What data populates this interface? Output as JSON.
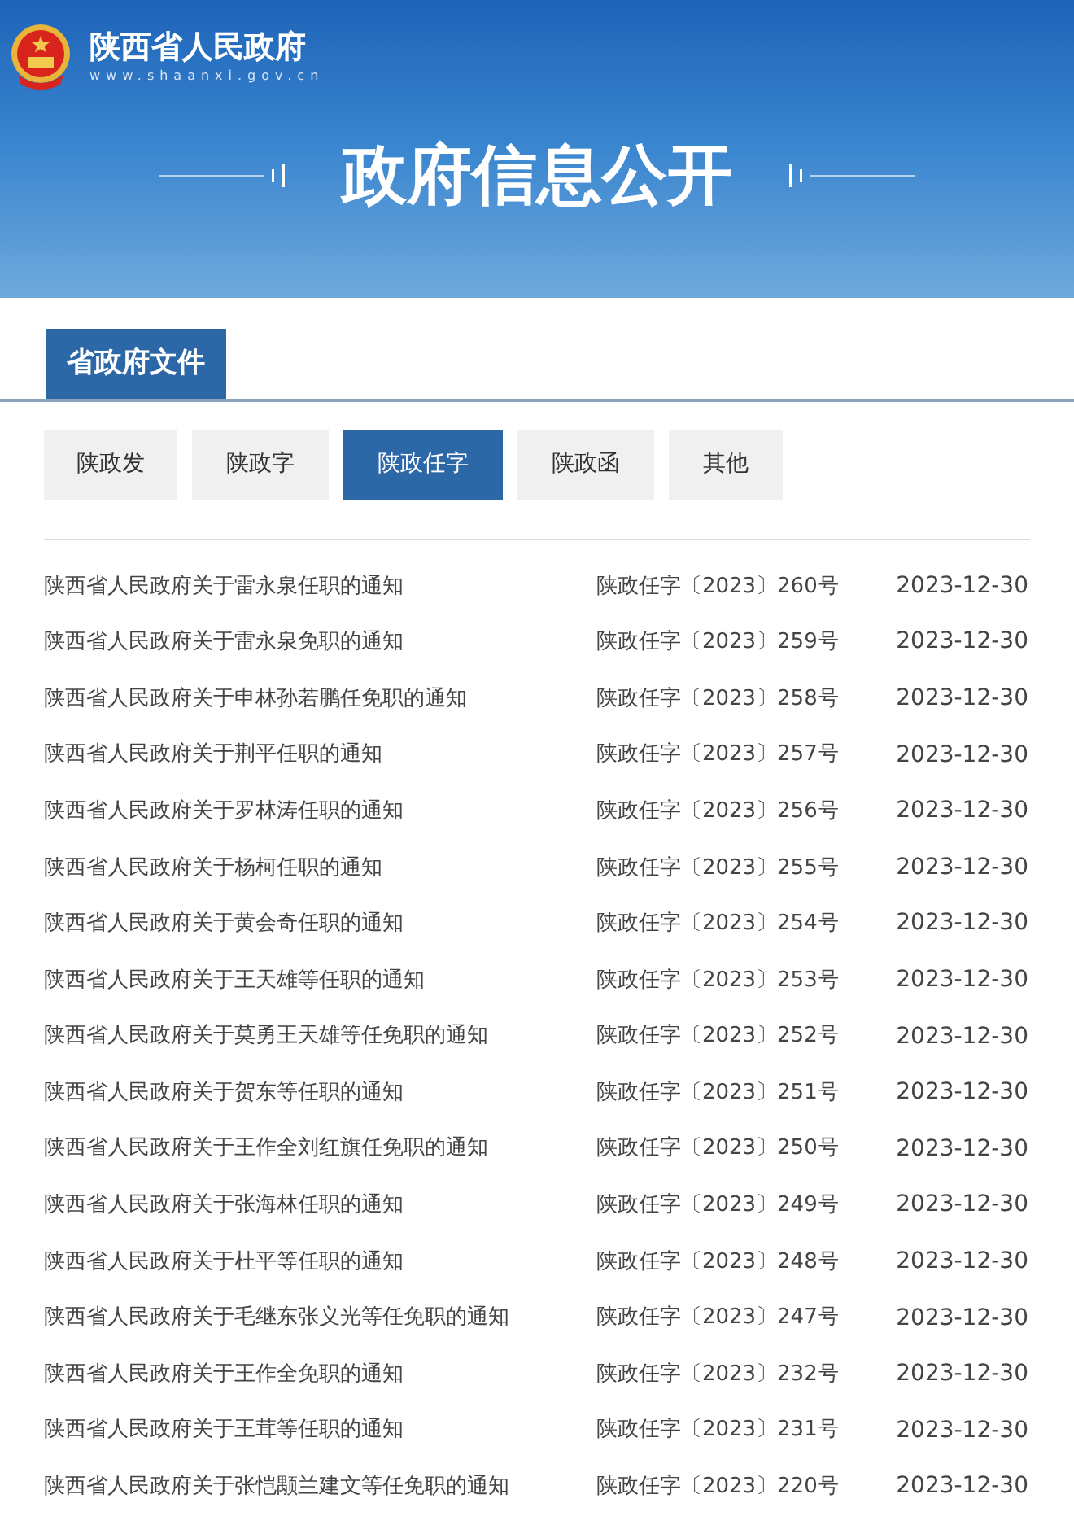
{
  "header": {
    "site_name": "陕西省人民政府",
    "site_url": "www.shaanxi.gov.cn",
    "banner_title": "政府信息公开"
  },
  "section": {
    "title": "省政府文件"
  },
  "tabs": [
    {
      "label": "陕政发",
      "selected": false
    },
    {
      "label": "陕政字",
      "selected": false
    },
    {
      "label": "陕政任字",
      "selected": true
    },
    {
      "label": "陕政函",
      "selected": false
    },
    {
      "label": "其他",
      "selected": false
    }
  ],
  "documents": [
    {
      "title": "陕西省人民政府关于雷永泉任职的通知",
      "number": "陕政任字〔2023〕260号",
      "date": "2023-12-30"
    },
    {
      "title": "陕西省人民政府关于雷永泉免职的通知",
      "number": "陕政任字〔2023〕259号",
      "date": "2023-12-30"
    },
    {
      "title": "陕西省人民政府关于申林孙若鹏任免职的通知",
      "number": "陕政任字〔2023〕258号",
      "date": "2023-12-30"
    },
    {
      "title": "陕西省人民政府关于荆平任职的通知",
      "number": "陕政任字〔2023〕257号",
      "date": "2023-12-30"
    },
    {
      "title": "陕西省人民政府关于罗林涛任职的通知",
      "number": "陕政任字〔2023〕256号",
      "date": "2023-12-30"
    },
    {
      "title": "陕西省人民政府关于杨柯任职的通知",
      "number": "陕政任字〔2023〕255号",
      "date": "2023-12-30"
    },
    {
      "title": "陕西省人民政府关于黄会奇任职的通知",
      "number": "陕政任字〔2023〕254号",
      "date": "2023-12-30"
    },
    {
      "title": "陕西省人民政府关于王天雄等任职的通知",
      "number": "陕政任字〔2023〕253号",
      "date": "2023-12-30"
    },
    {
      "title": "陕西省人民政府关于莫勇王天雄等任免职的通知",
      "number": "陕政任字〔2023〕252号",
      "date": "2023-12-30"
    },
    {
      "title": "陕西省人民政府关于贺东等任职的通知",
      "number": "陕政任字〔2023〕251号",
      "date": "2023-12-30"
    },
    {
      "title": "陕西省人民政府关于王作全刘红旗任免职的通知",
      "number": "陕政任字〔2023〕250号",
      "date": "2023-12-30"
    },
    {
      "title": "陕西省人民政府关于张海林任职的通知",
      "number": "陕政任字〔2023〕249号",
      "date": "2023-12-30"
    },
    {
      "title": "陕西省人民政府关于杜平等任职的通知",
      "number": "陕政任字〔2023〕248号",
      "date": "2023-12-30"
    },
    {
      "title": "陕西省人民政府关于毛继东张义光等任免职的通知",
      "number": "陕政任字〔2023〕247号",
      "date": "2023-12-30"
    },
    {
      "title": "陕西省人民政府关于王作全免职的通知",
      "number": "陕政任字〔2023〕232号",
      "date": "2023-12-30"
    },
    {
      "title": "陕西省人民政府关于王茸等任职的通知",
      "number": "陕政任字〔2023〕231号",
      "date": "2023-12-30"
    },
    {
      "title": "陕西省人民政府关于张恺颙兰建文等任免职的通知",
      "number": "陕政任字〔2023〕220号",
      "date": "2023-12-30"
    }
  ]
}
